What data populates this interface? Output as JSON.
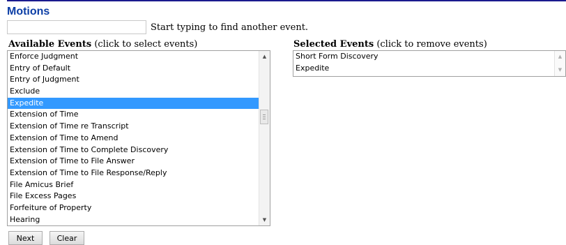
{
  "page": {
    "title": "Motions"
  },
  "search": {
    "value": "",
    "placeholder": "",
    "hint": "Start typing to find another event."
  },
  "available": {
    "heading_bold": "Available Events",
    "heading_note": "(click to select events)",
    "items": [
      {
        "label": "Enforce Judgment",
        "selected": false
      },
      {
        "label": "Entry of Default",
        "selected": false
      },
      {
        "label": "Entry of Judgment",
        "selected": false
      },
      {
        "label": "Exclude",
        "selected": false
      },
      {
        "label": "Expedite",
        "selected": true
      },
      {
        "label": "Extension of Time",
        "selected": false
      },
      {
        "label": "Extension of Time re Transcript",
        "selected": false
      },
      {
        "label": "Extension of Time to Amend",
        "selected": false
      },
      {
        "label": "Extension of Time to Complete Discovery",
        "selected": false
      },
      {
        "label": "Extension of Time to File Answer",
        "selected": false
      },
      {
        "label": "Extension of Time to File Response/Reply",
        "selected": false
      },
      {
        "label": "File Amicus Brief",
        "selected": false
      },
      {
        "label": "File Excess Pages",
        "selected": false
      },
      {
        "label": "Forfeiture of Property",
        "selected": false
      },
      {
        "label": "Hearing",
        "selected": false
      }
    ]
  },
  "selected": {
    "heading_bold": "Selected Events",
    "heading_note": "(click to remove events)",
    "items": [
      {
        "label": "Short Form Discovery"
      },
      {
        "label": "Expedite"
      }
    ]
  },
  "buttons": {
    "next": "Next",
    "clear": "Clear"
  },
  "icons": {
    "scroll_up": "scroll-up-arrow-icon",
    "scroll_down": "scroll-down-arrow-icon"
  },
  "colors": {
    "title": "#0c3ea6",
    "rule": "#1a1a8e",
    "selection": "#3399ff"
  }
}
